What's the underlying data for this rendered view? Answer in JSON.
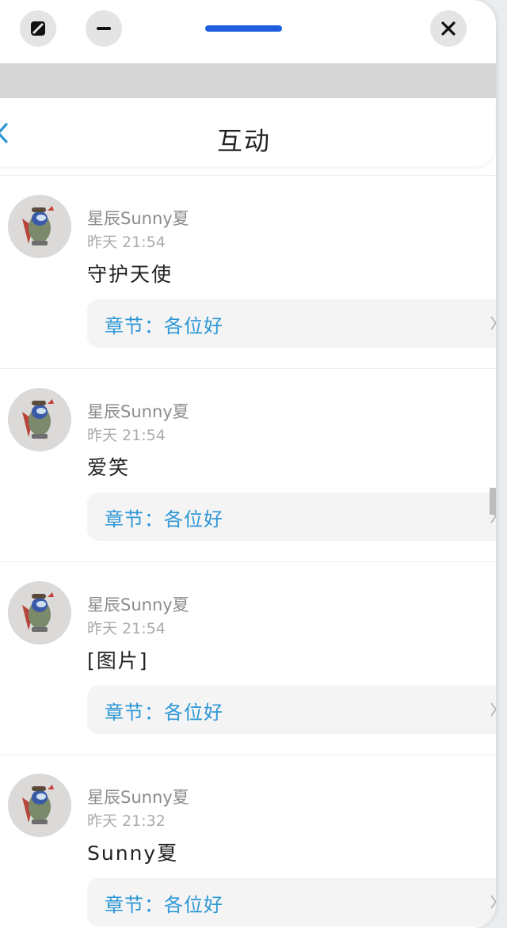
{
  "window": {
    "controls": {
      "left1_icon": "split-screen-icon",
      "left2_icon": "minimize-icon",
      "close_icon": "close-icon"
    },
    "accent_color": "#1d5fe0"
  },
  "header": {
    "title": "互动",
    "back_icon": "chevron-left-icon",
    "back_color": "#2d97d6"
  },
  "items": [
    {
      "username": "星辰Sunny夏",
      "time": "昨天 21:54",
      "message": "守护天使",
      "chapter": "章节：各位好"
    },
    {
      "username": "星辰Sunny夏",
      "time": "昨天 21:54",
      "message": "爱笑",
      "chapter": "章节：各位好"
    },
    {
      "username": "星辰Sunny夏",
      "time": "昨天 21:54",
      "message": "[图片]",
      "chapter": "章节：各位好"
    },
    {
      "username": "星辰Sunny夏",
      "time": "昨天 21:32",
      "message": "Sunny夏",
      "chapter": "章节：各位好"
    }
  ],
  "colors": {
    "link": "#2d97d6",
    "username": "#8c8c8c",
    "time": "#ababab"
  }
}
